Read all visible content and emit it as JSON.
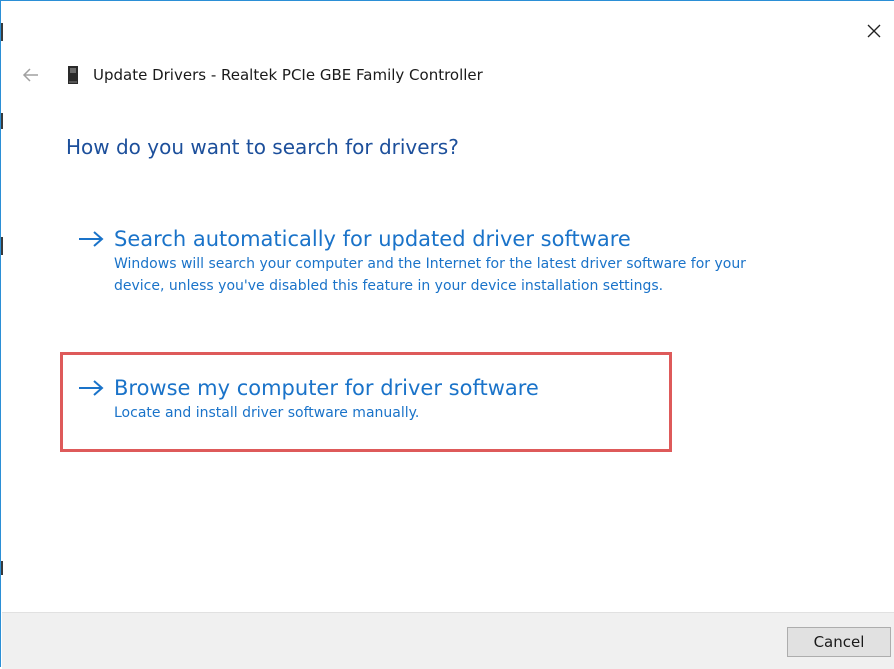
{
  "window": {
    "title": "Update Drivers - Realtek PCIe GBE Family Controller"
  },
  "icons": {
    "close": "close-icon",
    "back": "back-arrow-icon",
    "device": "network-adapter-icon",
    "option_arrow": "right-arrow-icon"
  },
  "main": {
    "question": "How do you want to search for drivers?",
    "options": [
      {
        "title": "Search automatically for updated driver software",
        "description": "Windows will search your computer and the Internet for the latest driver software for your device, unless you've disabled this feature in your device installation settings."
      },
      {
        "title": "Browse my computer for driver software",
        "description": "Locate and install driver software manually."
      }
    ]
  },
  "footer": {
    "cancel_label": "Cancel"
  },
  "colors": {
    "accent": "#1a73c9",
    "heading": "#1c4f9b",
    "highlight": "#de5a5a",
    "footer_bg": "#f0f0f0"
  }
}
